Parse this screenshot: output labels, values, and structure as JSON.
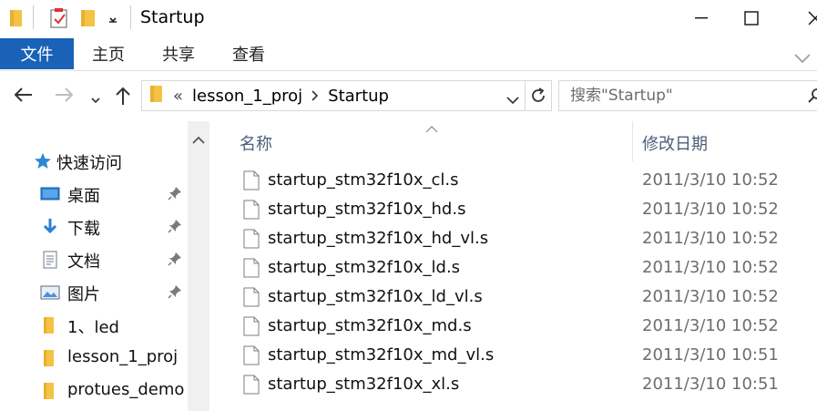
{
  "window": {
    "title": "Startup"
  },
  "ribbon": {
    "tabs": [
      "文件",
      "主页",
      "共享",
      "查看"
    ]
  },
  "address": {
    "overflow": "«",
    "breadcrumbs": [
      "lesson_1_proj",
      "Startup"
    ]
  },
  "search": {
    "placeholder": "搜索\"Startup\""
  },
  "nav_pane": {
    "quick_access_label": "快速访问",
    "items": [
      {
        "label": "桌面",
        "icon": "desktop-icon",
        "pinned": true
      },
      {
        "label": "下载",
        "icon": "download-icon",
        "pinned": true
      },
      {
        "label": "文档",
        "icon": "document-icon",
        "pinned": true
      },
      {
        "label": "图片",
        "icon": "pictures-icon",
        "pinned": true
      },
      {
        "label": "1、led",
        "icon": "folder-icon",
        "pinned": false
      },
      {
        "label": "lesson_1_proj",
        "icon": "folder-icon",
        "pinned": false
      },
      {
        "label": "protues_demo",
        "icon": "folder-icon",
        "pinned": false
      }
    ]
  },
  "file_list": {
    "columns": {
      "name": "名称",
      "modified": "修改日期"
    },
    "rows": [
      {
        "name": "startup_stm32f10x_cl.s",
        "modified": "2011/3/10 10:52"
      },
      {
        "name": "startup_stm32f10x_hd.s",
        "modified": "2011/3/10 10:52"
      },
      {
        "name": "startup_stm32f10x_hd_vl.s",
        "modified": "2011/3/10 10:52"
      },
      {
        "name": "startup_stm32f10x_ld.s",
        "modified": "2011/3/10 10:52"
      },
      {
        "name": "startup_stm32f10x_ld_vl.s",
        "modified": "2011/3/10 10:52"
      },
      {
        "name": "startup_stm32f10x_md.s",
        "modified": "2011/3/10 10:52"
      },
      {
        "name": "startup_stm32f10x_md_vl.s",
        "modified": "2011/3/10 10:51"
      },
      {
        "name": "startup_stm32f10x_xl.s",
        "modified": "2011/3/10 10:51"
      }
    ]
  },
  "colors": {
    "accent": "#1a62b8",
    "folder": "#f4c244",
    "column_header": "#4c607a",
    "date_text": "#6d6d6d"
  }
}
